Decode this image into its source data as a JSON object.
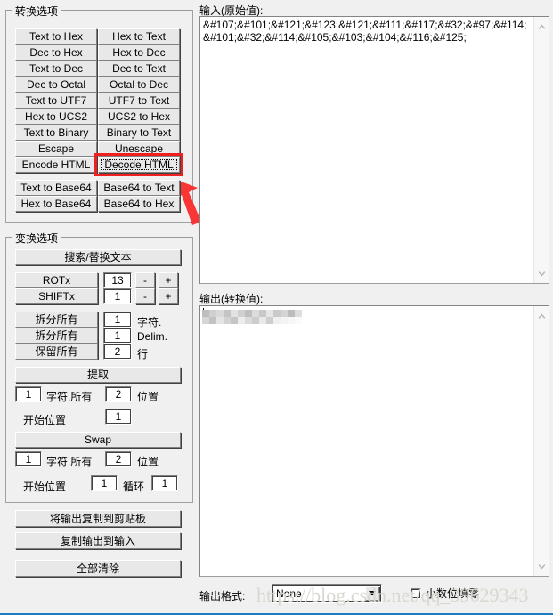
{
  "panels": {
    "conversion": {
      "title": "转换选项",
      "buttons_left": [
        "Text to Hex",
        "Dec to Hex",
        "Text to Dec",
        "Dec to Octal",
        "Text to UTF7",
        "Hex to UCS2",
        "Text to Binary",
        "Escape",
        "Encode HTML"
      ],
      "buttons_right": [
        "Hex to Text",
        "Hex to Dec",
        "Dec to Text",
        "Octal to Dec",
        "UTF7 to Text",
        "UCS2 to Hex",
        "Binary to Text",
        "Unescape",
        "Decode HTML"
      ],
      "base64_left": [
        "Text to Base64",
        "Hex to Base64"
      ],
      "base64_right": [
        "Base64 to Text",
        "Base64 to Hex"
      ],
      "highlighted_button": "Decode HTML",
      "highlight_color": "#f02020"
    },
    "transform": {
      "title": "变换选项",
      "search_replace_label": "搜索/替换文本",
      "rot": {
        "label": "ROTx",
        "value": "13",
        "minus": "-",
        "plus": "+"
      },
      "shift": {
        "label": "SHIFTx",
        "value": "1",
        "minus": "-",
        "plus": "+"
      },
      "split_chars": {
        "label": "拆分所有",
        "value": "1",
        "unit": "字符."
      },
      "split_delim": {
        "label": "拆分所有",
        "value": "1",
        "unit": "Delim."
      },
      "keep_lines": {
        "label": "保留所有",
        "value": "2",
        "unit": "行"
      },
      "extract": {
        "button": "提取",
        "count": "1",
        "count_unit": "字符.所有",
        "pos": "2",
        "pos_unit": "位置",
        "start_label": "开始位置",
        "start_value": "1"
      },
      "swap": {
        "button": "Swap",
        "count": "1",
        "count_unit": "字符.所有",
        "pos": "2",
        "pos_unit": "位置",
        "start_label": "开始位置",
        "start_value": "1",
        "loop_label": "循环",
        "loop_value": "1"
      }
    },
    "actions": {
      "copy_output_to_clipboard": "将输出复制到剪贴板",
      "copy_output_to_input": "复制输出到输入",
      "clear_all": "全部清除"
    }
  },
  "input_area": {
    "label": "输入(原始值):",
    "value": "&#107;&#101;&#121;&#123;&#121;&#111;&#117;&#32;&#97;&#114;&#101;&#32;&#114;&#105;&#103;&#104;&#116;&#125;"
  },
  "output_area": {
    "label": "输出(转换值):",
    "value": ""
  },
  "footer": {
    "format_label": "输出格式:",
    "format_value": "None",
    "checkbox_label": "小数位填零",
    "checkbox_checked": false
  },
  "watermark": {
    "text": "https://blog.csdn.net/qq_39629343"
  },
  "icons": {
    "scroll_up": "chevron-up-icon",
    "scroll_down": "chevron-down-icon",
    "combo_arrow": "chevron-down-icon",
    "pointer": "red-arrow-icon"
  }
}
